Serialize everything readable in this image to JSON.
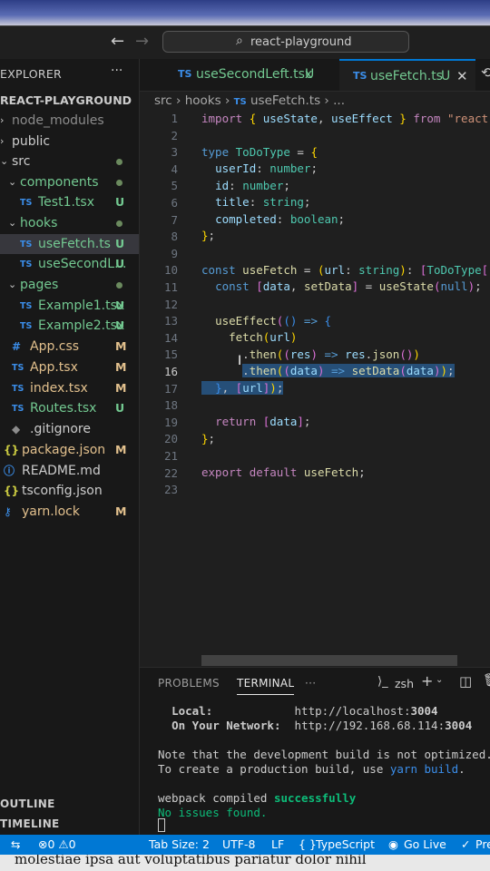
{
  "window": {
    "search_text": "react-playground"
  },
  "sidebar": {
    "title": "EXPLORER",
    "more": "···",
    "project": "REACT-PLAYGROUND",
    "items": [
      {
        "label": "node_modules",
        "badge": "",
        "kind": "folder"
      },
      {
        "label": "public",
        "badge": "",
        "kind": "folder"
      },
      {
        "label": "src",
        "badge": "",
        "kind": "folder-open"
      },
      {
        "label": "components",
        "badge": "",
        "kind": "folder-open"
      },
      {
        "label": "Test1.tsx",
        "badge": "U",
        "kind": "ts"
      },
      {
        "label": "hooks",
        "badge": "",
        "kind": "folder-open"
      },
      {
        "label": "useFetch.ts",
        "badge": "U",
        "kind": "ts"
      },
      {
        "label": "useSecondL...",
        "badge": "U",
        "kind": "ts"
      },
      {
        "label": "pages",
        "badge": "",
        "kind": "folder-open"
      },
      {
        "label": "Example1.tsx",
        "badge": "U",
        "kind": "ts"
      },
      {
        "label": "Example2.tsx",
        "badge": "U",
        "kind": "ts"
      },
      {
        "label": "App.css",
        "badge": "M",
        "kind": "css"
      },
      {
        "label": "App.tsx",
        "badge": "M",
        "kind": "ts"
      },
      {
        "label": "index.tsx",
        "badge": "M",
        "kind": "ts"
      },
      {
        "label": "Routes.tsx",
        "badge": "U",
        "kind": "ts"
      },
      {
        "label": ".gitignore",
        "badge": "",
        "kind": "file"
      },
      {
        "label": "package.json",
        "badge": "M",
        "kind": "json"
      },
      {
        "label": "README.md",
        "badge": "",
        "kind": "md"
      },
      {
        "label": "tsconfig.json",
        "badge": "",
        "kind": "json"
      },
      {
        "label": "yarn.lock",
        "badge": "M",
        "kind": "lock"
      }
    ],
    "outline": "OUTLINE",
    "timeline": "TIMELINE"
  },
  "tabs": [
    {
      "prefix": "TS",
      "label": "useSecondLeft.tsx",
      "status": "U"
    },
    {
      "prefix": "TS",
      "label": "useFetch.ts",
      "status": "U"
    }
  ],
  "breadcrumb": [
    "src",
    "hooks",
    "useFetch.ts",
    "..."
  ],
  "editor": {
    "line_numbers": [
      "1",
      "2",
      "3",
      "4",
      "5",
      "6",
      "7",
      "8",
      "9",
      "10",
      "11",
      "12",
      "13",
      "14",
      "15",
      "16",
      "17",
      "18",
      "19",
      "20",
      "21",
      "22",
      "23"
    ],
    "current_line": 16
  },
  "panel": {
    "tabs": [
      "PROBLEMS",
      "TERMINAL",
      "···"
    ],
    "shell": "zsh",
    "local_label": "Local:",
    "local_url_prefix": "http://localhost:",
    "local_port": "3004",
    "network_label": "On Your Network:",
    "network_url_prefix": "http://192.168.68.114:",
    "network_port": "3004",
    "note1": "Note that the development build is not optimized.",
    "note2_prefix": "To create a production build, use ",
    "note2_cmd": "yarn build",
    "note2_suffix": ".",
    "compiled_prefix": "webpack compiled ",
    "compiled_status": "successfully",
    "no_issues": "No issues found."
  },
  "statusbar": {
    "errors": "0",
    "warnings": "0",
    "tab_size": "Tab Size: 2",
    "encoding": "UTF-8",
    "eol": "LF",
    "language": "TypeScript",
    "golive": "Go Live",
    "prettier": "Pre"
  },
  "bottom_text": "molestiae ipsa aut voluptatibus pariatur dolor nihil",
  "colors": {
    "accent": "#0078d4",
    "untracked": "#73c991",
    "modified": "#e2c08d"
  }
}
